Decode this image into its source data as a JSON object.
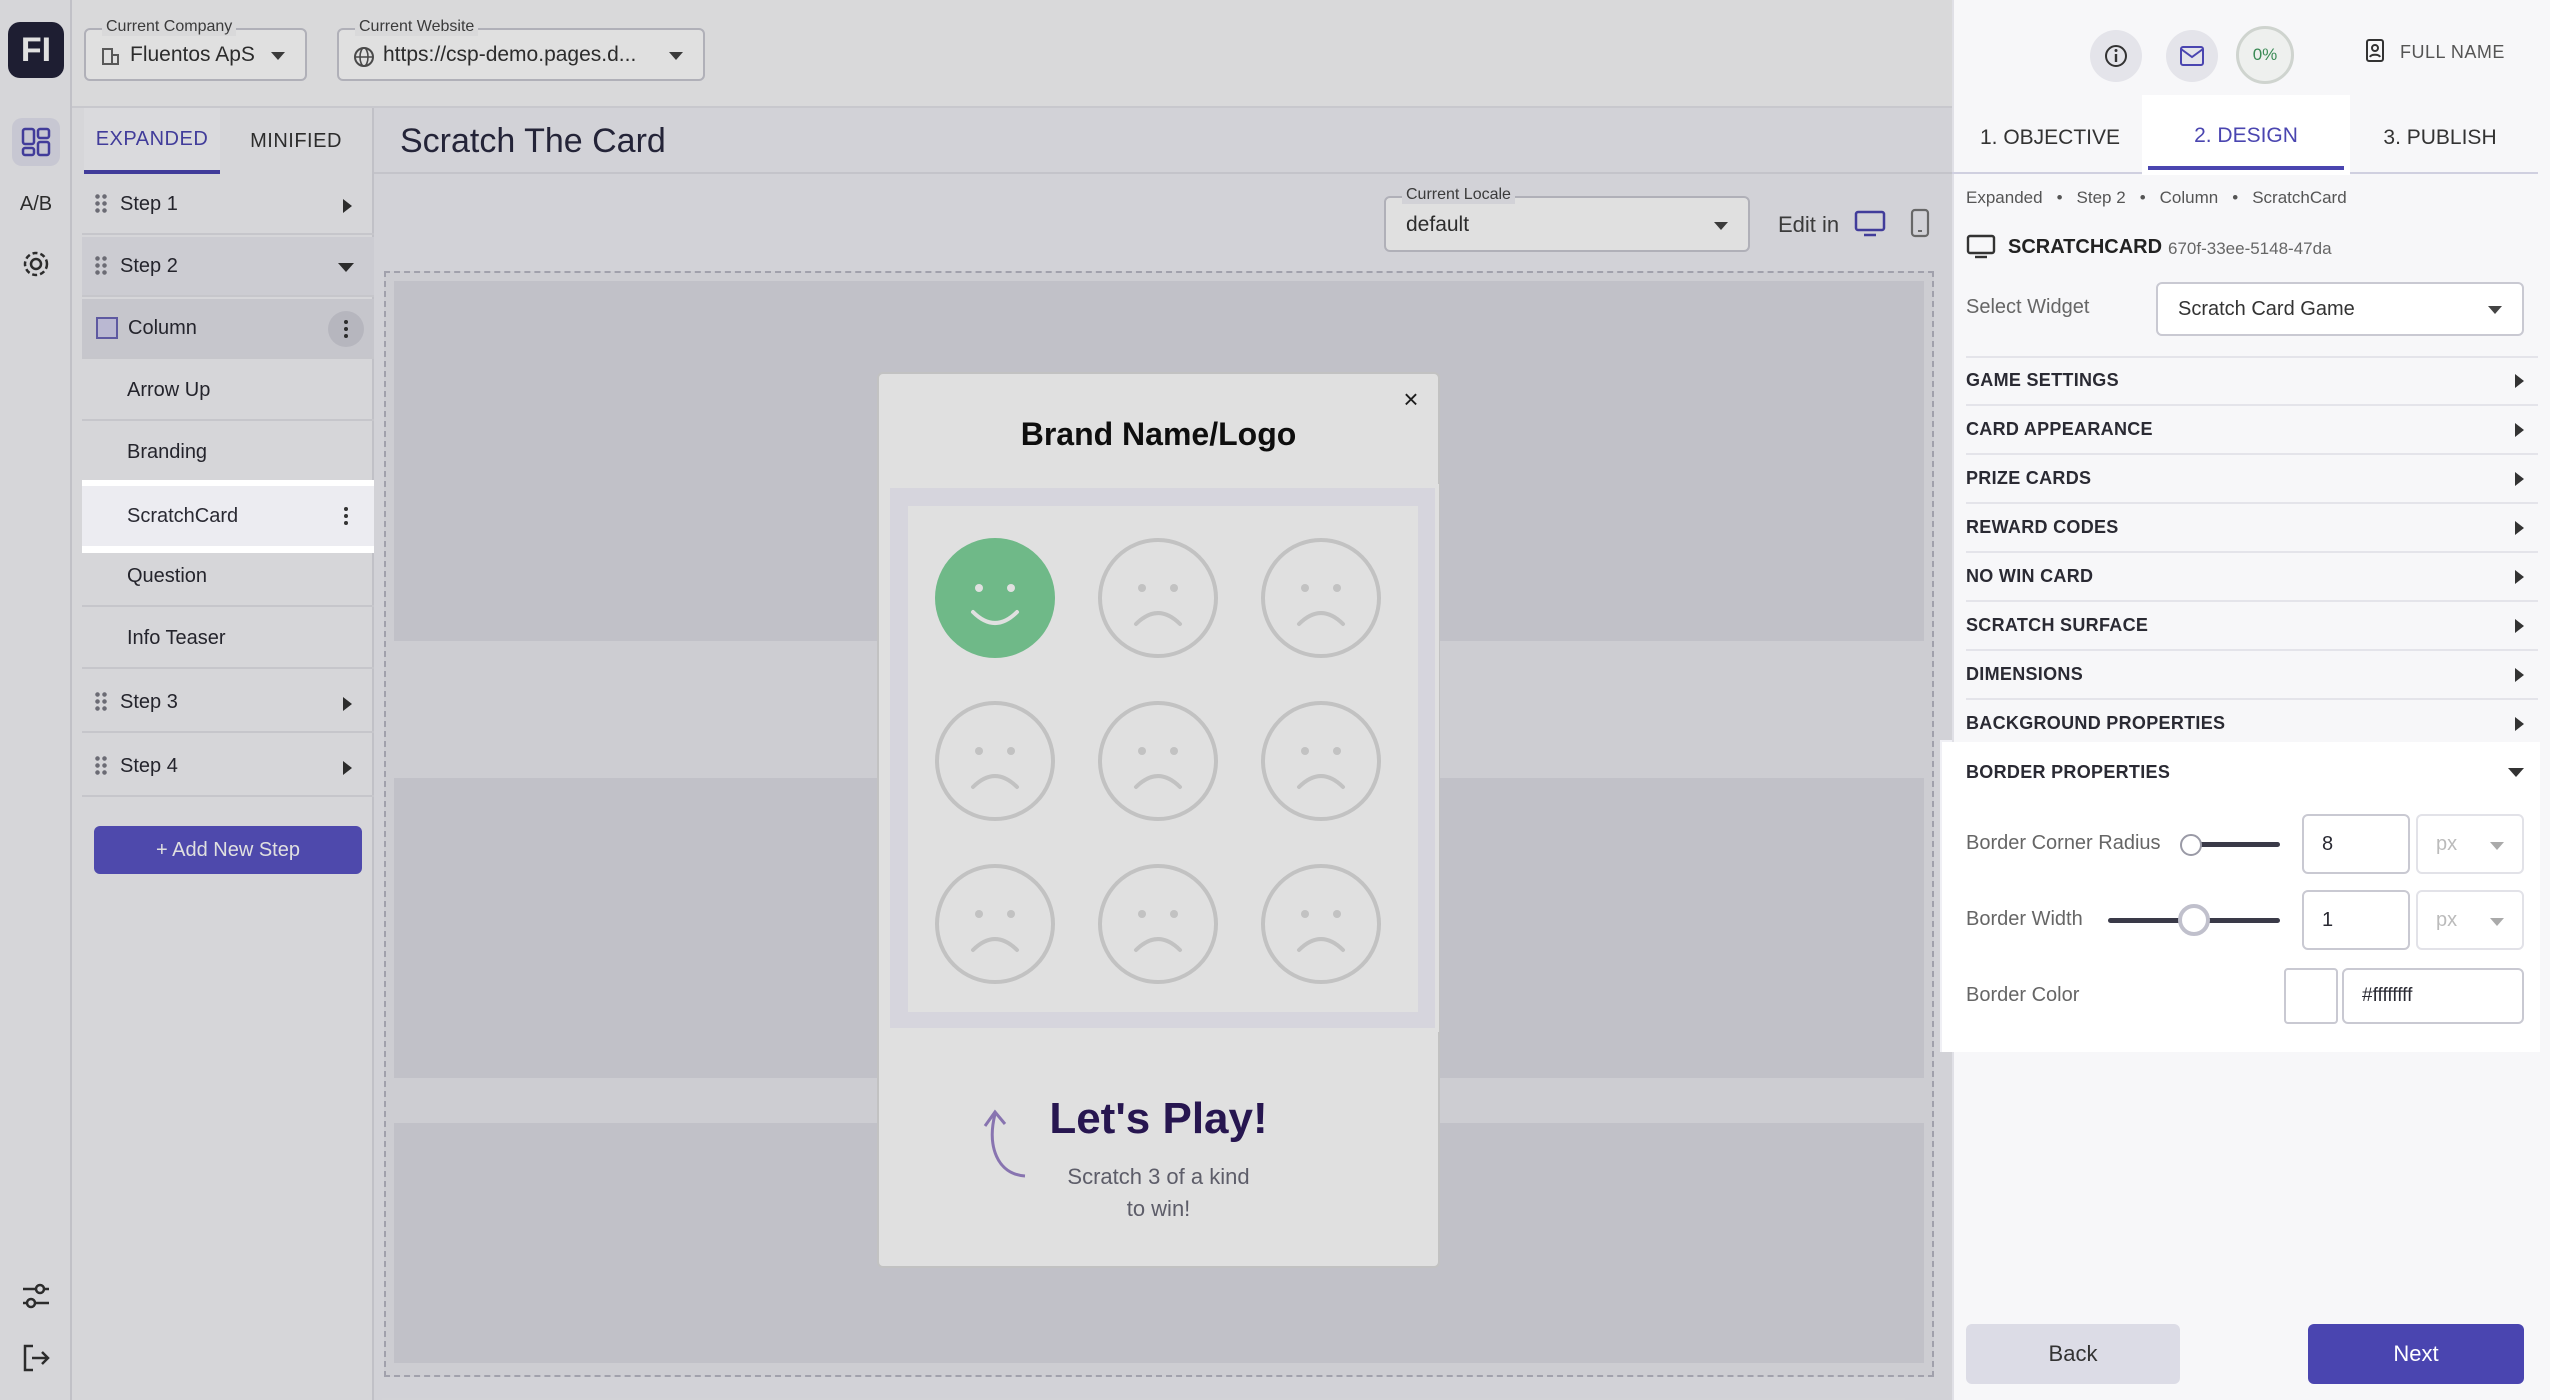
{
  "rail": {
    "logo": "FI",
    "ab_label": "A/B"
  },
  "header": {
    "company": {
      "label": "Current Company",
      "value": "Fluentos ApS"
    },
    "website": {
      "label": "Current Website",
      "value": "https://csp-demo.pages.d..."
    }
  },
  "tree": {
    "tabs": [
      "EXPANDED",
      "MINIFIED"
    ],
    "items": {
      "step1": "Step 1",
      "step2": "Step 2",
      "column": "Column",
      "arrow_up": "Arrow Up",
      "branding": "Branding",
      "scratchcard": "ScratchCard",
      "question": "Question",
      "info_teaser": "Info Teaser",
      "step3": "Step 3",
      "step4": "Step 4"
    },
    "add_step": "+ Add New Step"
  },
  "canvas": {
    "title": "Scratch The Card",
    "locale_label": "Current Locale",
    "locale_value": "default",
    "edit_in": "Edit in"
  },
  "preview": {
    "close": "×",
    "brand": "Brand Name/Logo",
    "play_title": "Let's Play!",
    "play_sub_1": "Scratch 3 of a kind",
    "play_sub_2": "to win!",
    "faces": [
      "happy",
      "sad",
      "sad",
      "sad",
      "sad",
      "sad",
      "sad",
      "sad",
      "sad"
    ]
  },
  "topbar": {
    "progress": "0%",
    "user_name": "FULL NAME"
  },
  "steps_tabs": [
    "1. OBJECTIVE",
    "2. DESIGN",
    "3. PUBLISH"
  ],
  "breadcrumb": [
    "Expanded",
    "Step 2",
    "Column",
    "ScratchCard"
  ],
  "widget": {
    "type_label": "SCRATCHCARD",
    "id": "670f-33ee-5148-47da",
    "select_label": "Select Widget",
    "select_value": "Scratch Card Game"
  },
  "sections": [
    "GAME SETTINGS",
    "CARD APPEARANCE",
    "PRIZE CARDS",
    "REWARD CODES",
    "NO WIN CARD",
    "SCRATCH SURFACE",
    "DIMENSIONS",
    "BACKGROUND PROPERTIES",
    "BORDER PROPERTIES"
  ],
  "border": {
    "radius_label": "Border Corner Radius",
    "radius_value": "8",
    "width_label": "Border Width",
    "width_value": "1",
    "unit": "px",
    "color_label": "Border Color",
    "color_value": "#ffffffff"
  },
  "footer": {
    "back": "Back",
    "next": "Next"
  },
  "colors": {
    "accent": "#4a45b0",
    "happy_face": "#7fd39b",
    "sad_face": "#dddddd",
    "title_dark": "#2d1a5c"
  },
  "icons": [
    "layout-icon",
    "ab-test-icon",
    "gear-icon",
    "sliders-icon",
    "logout-icon",
    "building-icon",
    "globe-icon",
    "info-icon",
    "mail-icon",
    "user-doc-icon",
    "desktop-icon",
    "mobile-icon",
    "close-icon",
    "arrow-icon"
  ]
}
